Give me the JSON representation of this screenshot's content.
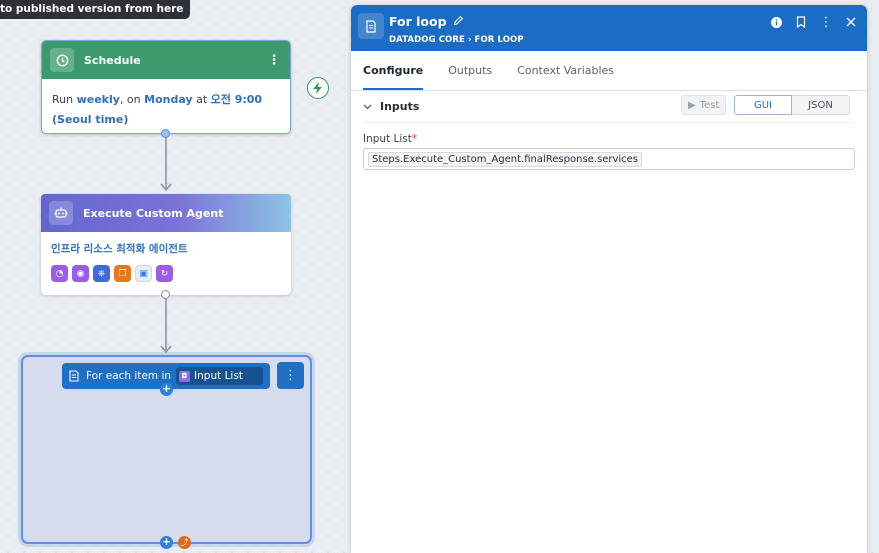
{
  "tooltip": "to published version from here",
  "schedule": {
    "title": "Schedule",
    "body_run": "Run ",
    "body_freq": "weekly",
    "body_on": ", on ",
    "body_day": "Monday",
    "body_at": " at ",
    "body_time": "오전 9:00",
    "body_tz": "(Seoul time)"
  },
  "agent": {
    "title": "Execute Custom Agent",
    "subtitle": "인프라 리소스 최적화 에이전트",
    "chips": [
      {
        "icon": "gauge-icon",
        "color": "#9b5de5",
        "glyph": "◔"
      },
      {
        "icon": "target-icon",
        "color": "#9b5de5",
        "glyph": "◉"
      },
      {
        "icon": "kubernetes-icon",
        "color": "#3f6bd6",
        "glyph": "⎈"
      },
      {
        "icon": "layers-icon",
        "color": "#e8791a",
        "glyph": "❐"
      },
      {
        "icon": "monitor-icon",
        "color": "#e8edf3",
        "glyph": "▣"
      },
      {
        "icon": "cycle-icon",
        "color": "#9b5de5",
        "glyph": "↻"
      }
    ]
  },
  "loop": {
    "prefix": "For each item in",
    "chip_label": "Input List"
  },
  "panel": {
    "title": "For loop",
    "crumb_a": "DATADOG CORE",
    "crumb_b": "FOR LOOP",
    "tabs": [
      {
        "label": "Configure",
        "active": true
      },
      {
        "label": "Outputs",
        "active": false
      },
      {
        "label": "Context Variables",
        "active": false
      }
    ],
    "section_title": "Inputs",
    "test_label": "Test",
    "gui_label": "GUI",
    "json_label": "JSON",
    "field_label": "Input List",
    "field_required": "*",
    "field_value": "Steps.Execute_Custom_Agent.finalResponse.services"
  },
  "colors": {
    "brand": "#1a6cc4",
    "schedule_green": "#3d9a6c",
    "agent_purple": "#6366d1"
  }
}
